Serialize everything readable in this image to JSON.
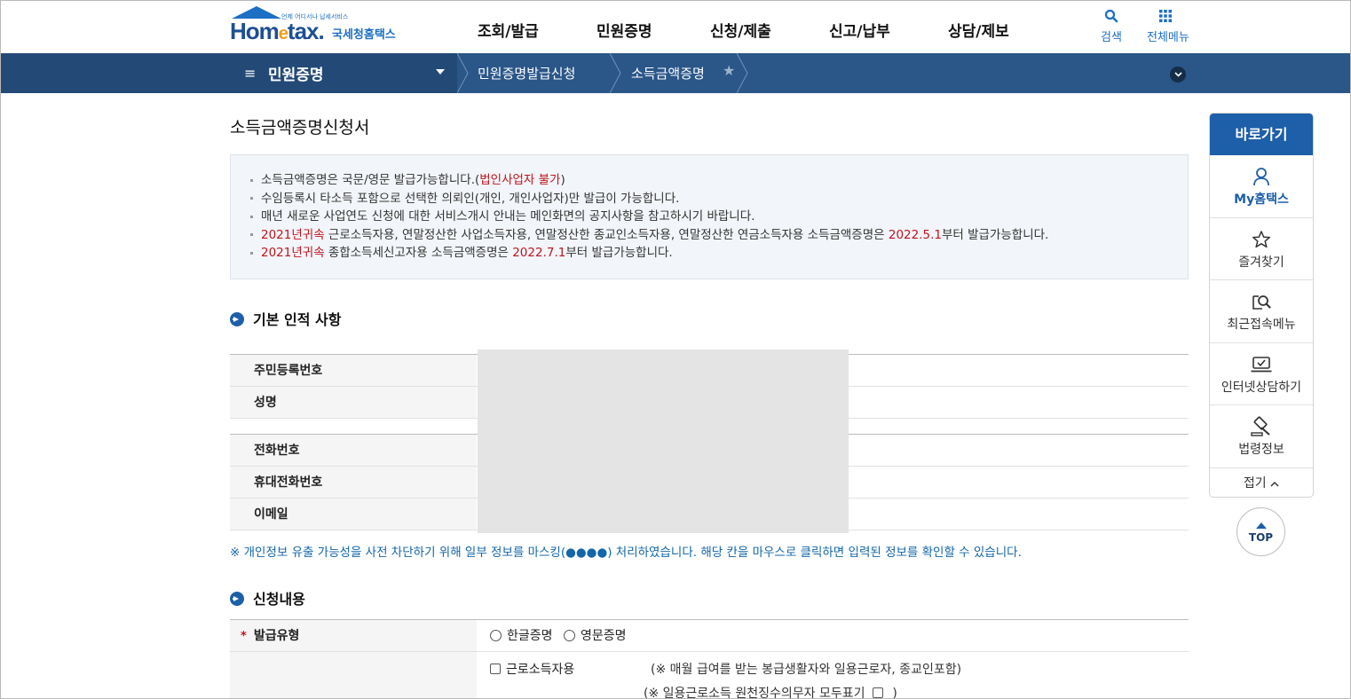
{
  "header": {
    "logo_word": "Hometax.",
    "logo_small": "언제 어디서나 납세서비스",
    "logo_ko": "국세청홈택스",
    "gnb": [
      "조회/발급",
      "민원증명",
      "신청/제출",
      "신고/납부",
      "상담/제보"
    ],
    "search_label": "검색",
    "allmenu_label": "전체메뉴"
  },
  "nav": {
    "main": "민원증명",
    "crumbs": [
      "민원증명발급신청",
      "소득금액증명"
    ]
  },
  "page_title": "소득금액증명신청서",
  "notice": {
    "l1_a": "소득금액증명은 국문/영문 발급가능합니다.(",
    "l1_red": "법인사업자 불가",
    "l1_b": ")",
    "l2": "수임등록시 타소득 포함으로 선택한 의뢰인(개인, 개인사업자)만 발급이 가능합니다.",
    "l3": "매년 새로운 사업연도 신청에 대한 서비스개시 안내는 메인화면의 공지사항을 참고하시기 바랍니다.",
    "l4_red1": "2021년귀속",
    "l4_a": " 근로소득자용, 연말정산한 사업소득자용, 연말정산한 종교인소득자용, 연말정산한 연금소득자용 소득금액증명은 ",
    "l4_red2": "2022.5.1",
    "l4_b": "부터 발급가능합니다.",
    "l5_red1": "2021년귀속",
    "l5_a": " 종합소득세신고자용 소득금액증명은 ",
    "l5_red2": "2022.7.1",
    "l5_b": "부터 발급가능합니다."
  },
  "section_basic": {
    "title": "기본 인적 사항",
    "rows": [
      "주민등록번호",
      "성명",
      "전화번호",
      "휴대전화번호",
      "이메일"
    ],
    "mask_note": "※ 개인정보 유출 가능성을 사전 차단하기 위해 일부 정보를 마스킹(●●●●) 처리하였습니다. 해당 칸을 마우스로 클릭하면 입력된 정보를 확인할 수 있습니다."
  },
  "section_apply": {
    "title": "신청내용",
    "type_label": "발급유형",
    "required_mark": "*",
    "radio_ko": "한글증명",
    "radio_en": "영문증명",
    "chk_wage": "근로소득자용",
    "wage_note": "(※ 매월 급여를 받는 봉급생활자와 일용근로자, 종교인포함)",
    "daily_note_a": "(※ 일용근로소득 원천징수의무자 모두표기",
    "daily_note_b": ")"
  },
  "quick": {
    "head": "바로가기",
    "items": [
      "My홈택스",
      "즐겨찾기",
      "최근접속메뉴",
      "인터넷상담하기",
      "법령정보"
    ],
    "fold": "접기",
    "top": "TOP"
  },
  "colors": {
    "primary": "#1d5fa8",
    "nav": "#2a5688",
    "accent_red": "#c0141e"
  }
}
